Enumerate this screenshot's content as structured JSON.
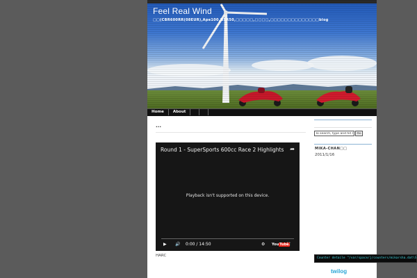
{
  "header": {
    "title": "Feel Real Wind",
    "description": "□□(CBR600RR(08EUR),Ape100,NSR50,□□□□□,□□□□,□□□□□□□□□□□□□□blog"
  },
  "nav": {
    "items": [
      {
        "label": "Home"
      },
      {
        "label": "About"
      },
      {
        "label": ""
      },
      {
        "label": ""
      }
    ]
  },
  "post": {
    "title": "...",
    "video": {
      "title": "Round 1 - SuperSports 600cc Race 2 Highlights - 2...",
      "message": "Playback isn't supported on this device.",
      "time": "0:00 / 14:50",
      "icons": [
        "share-icon",
        "play-icon",
        "volume-icon",
        "settings-icon",
        "youtube-logo",
        "fullscreen-icon"
      ]
    },
    "caption": "HARC"
  },
  "sidebar": {
    "search_placeholder": "To search, type and hit Go",
    "search_button": "Go",
    "heading": "MIKA-CHAN□□",
    "date": "2011/1/16",
    "counter_text": "Counter detaile \"/var/space/j/counters/mikarsha.dat\\STCO",
    "twilog_label": "twilog"
  },
  "colors": {
    "background": "#5b5b5b",
    "page": "#ffffff",
    "nav": "#111111",
    "sidebar_rule": "#8cb3d4",
    "counter_text": "#41d4df",
    "twilog": "#2aa6d6"
  }
}
